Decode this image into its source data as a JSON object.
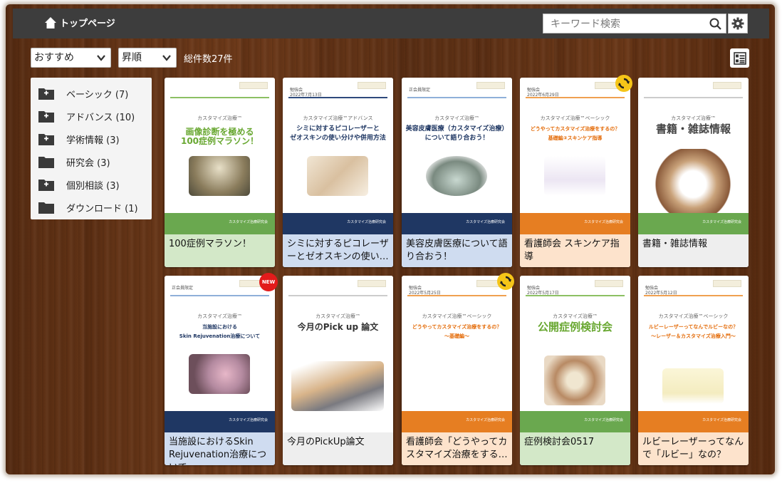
{
  "header": {
    "home_label": "トップページ"
  },
  "search": {
    "placeholder": "キーワード検索"
  },
  "controls": {
    "sort_value": "おすすめ",
    "order_value": "昇順",
    "total_count": "総件数27件"
  },
  "sidebar": {
    "items": [
      {
        "label": "ベーシック (7)",
        "icon": "folder-plus-icon"
      },
      {
        "label": "アドバンス (10)",
        "icon": "folder-plus-icon"
      },
      {
        "label": "学術情報 (3)",
        "icon": "folder-plus-icon"
      },
      {
        "label": "研究会 (3)",
        "icon": "folder-icon"
      },
      {
        "label": "個別相談 (3)",
        "icon": "folder-plus-icon"
      },
      {
        "label": "ダウンロード (1)",
        "icon": "folder-icon"
      }
    ]
  },
  "cards": [
    {
      "caption": "100症例マラソン！",
      "caption_color": "#d3e8c8",
      "pre_label": "",
      "brand": "カスタマイズ治療™",
      "headline": "画像診断を極める\n100症例マラソン！",
      "headline_color": "#69a832",
      "rule_color": "#8cc063",
      "footer_color": "#6aa84f",
      "footer_text": "カスタマイズ治療研究会"
    },
    {
      "caption": "シミに対するピコレーザーとゼオスキンの使い…",
      "caption_color": "#cfdcf0",
      "pre_label": "勉強会\n2022年7月13日",
      "brand": "カスタマイズ治療™アドバンス",
      "headline": "シミに対するピコレーザーと\nゼオスキンの使い分けや併用方法",
      "headline_color": "#1f3763",
      "rule_color": "#2e4a7d",
      "footer_color": "#1f3763",
      "footer_text": "カスタマイズ治療研究会"
    },
    {
      "caption": "美容皮膚医療について語り合おう！",
      "caption_color": "#cfdcf0",
      "pre_label": "正会員限定",
      "brand": "カスタマイズ治療™",
      "headline": "美容皮膚医療（カスタマイズ治療）\nについて語り合おう！",
      "headline_color": "#1f3763",
      "rule_color": "#8fb0d9",
      "footer_color": "#1f3763",
      "footer_text": "カスタマイズ治療研究会"
    },
    {
      "caption": "看護師会 スキンケア指導",
      "caption_color": "#fde3cc",
      "pre_label": "勉強会\n2022年6月29日",
      "brand": "カスタマイズ治療™ベーシック",
      "headline": "どうやってカスタマイズ治療をするの？\n基礎編②スキンケア指導",
      "headline_color": "#e46c0a",
      "rule_color": "#f0a050",
      "footer_color": "#e67e22",
      "footer_text": "カスタマイズ治療研究会"
    },
    {
      "caption": "書籍・雑誌情報",
      "caption_color": "#eeeeee",
      "pre_label": "",
      "brand": "カスタマイズ治療™",
      "headline": "書籍・雑誌情報",
      "headline_color": "#444444",
      "rule_color": "#cccccc",
      "footer_color": "#6aa84f",
      "footer_text": "カスタマイズ治療研究会"
    },
    {
      "caption": "当施設におけるSkin Rejuvenation治療について",
      "caption_color": "#cfdcf0",
      "pre_label": "正会員限定",
      "brand": "カスタマイズ治療™",
      "headline": "当施設における\nSkin Rejuvenation治療について",
      "headline_color": "#1f3763",
      "rule_color": "#8fb0d9",
      "footer_color": "#1f3763",
      "footer_text": "カスタマイズ治療研究会"
    },
    {
      "caption": "今月のPickUp論文",
      "caption_color": "#eeeeee",
      "pre_label": "",
      "brand": "カスタマイズ治療™",
      "headline": "今月のPick up 論文",
      "headline_color": "#333333",
      "rule_color": "#cccccc",
      "footer_color": "#ffffff",
      "footer_text": ""
    },
    {
      "caption": "看護師会「どうやってカスタマイズ治療をする…",
      "caption_color": "#fde3cc",
      "pre_label": "勉強会\n2022年5月25日",
      "brand": "カスタマイズ治療™ベーシック",
      "headline": "どうやってカスタマイズ治療をするの？\n～基礎編～",
      "headline_color": "#e46c0a",
      "rule_color": "#f0a050",
      "footer_color": "#e67e22",
      "footer_text": "カスタマイズ治療研究会"
    },
    {
      "caption": "症例検討会0517",
      "caption_color": "#d3e8c8",
      "pre_label": "勉強会\n2022年5月17日",
      "brand": "カスタマイズ治療™",
      "headline": "公開症例検討会",
      "headline_color": "#69a832",
      "rule_color": "#8cc063",
      "footer_color": "#6aa84f",
      "footer_text": "カスタマイズ治療研究会"
    },
    {
      "caption": "ルビーレーザーってなんで「ルビー」なの？",
      "caption_color": "#fde3cc",
      "pre_label": "勉強会\n2022年5月12日",
      "brand": "カスタマイズ治療™ベーシック",
      "headline": "ルビーレーザーってなんでルビーなの？\n～レーザー＆カスタマイズ治療入門～",
      "headline_color": "#e46c0a",
      "rule_color": "#f0a050",
      "footer_color": "#e67e22",
      "footer_text": "カスタマイズ治療研究会"
    }
  ],
  "badges": {
    "new_label": "NEW"
  }
}
